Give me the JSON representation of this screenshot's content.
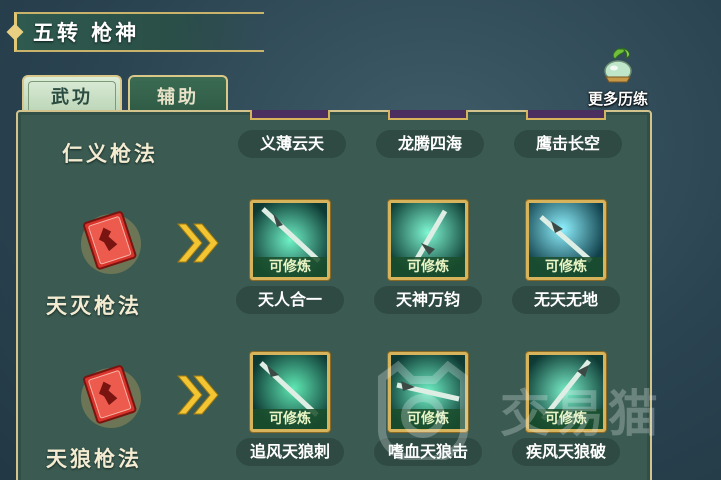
{
  "title": "五转 枪神",
  "tabs": [
    {
      "label": "武功",
      "active": true
    },
    {
      "label": "辅助",
      "active": false
    }
  ],
  "more_training": {
    "label": "更多历练",
    "icon": "jade-gourd-icon"
  },
  "skills": [
    {
      "name": "仁义枪法",
      "moves": [
        {
          "label": "义薄云天"
        },
        {
          "label": "龙腾四海"
        },
        {
          "label": "鹰击长空"
        }
      ]
    },
    {
      "name": "天灭枪法",
      "moves": [
        {
          "label": "天人合一",
          "status": "可修炼"
        },
        {
          "label": "天神万钧",
          "status": "可修炼"
        },
        {
          "label": "无天无地",
          "status": "可修炼"
        }
      ]
    },
    {
      "name": "天狼枪法",
      "moves": [
        {
          "label": "追风天狼刺",
          "status": "可修炼"
        },
        {
          "label": "嗜血天狼击",
          "status": "可修炼"
        },
        {
          "label": "疾风天狼破",
          "status": "可修炼"
        }
      ]
    }
  ],
  "watermark": {
    "text": "交易猫"
  },
  "colors": {
    "panel": "#3b5b52",
    "gold_border": "#d7b45c",
    "status_bg": "#1a4e2c",
    "arrow": "#f3c532",
    "book_red": "#d8342c"
  }
}
